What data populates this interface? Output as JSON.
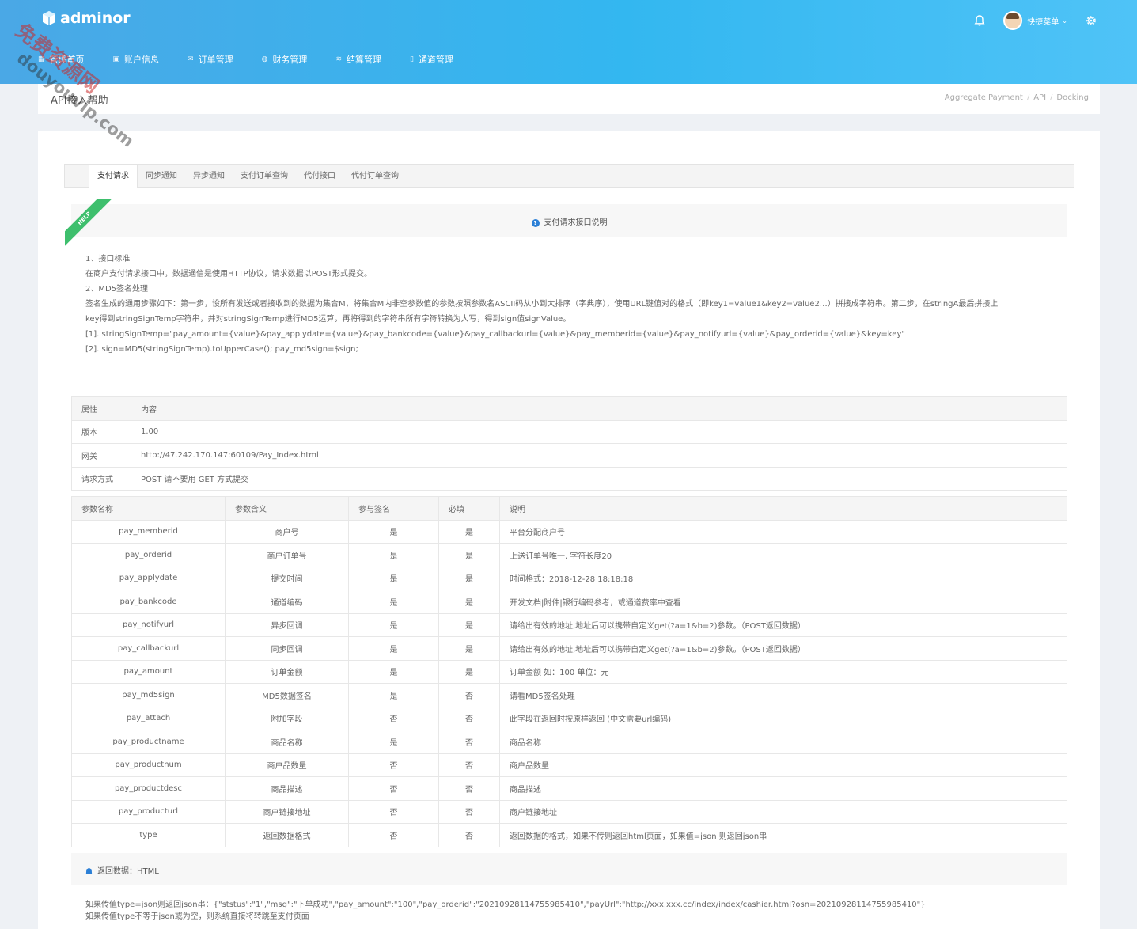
{
  "brand": {
    "name": "adminor"
  },
  "header": {
    "user_name": "快捷菜单",
    "caret": "⌄"
  },
  "nav": [
    {
      "label": "管理首页",
      "icon": "grid-icon"
    },
    {
      "label": "账户信息",
      "icon": "user-card-icon"
    },
    {
      "label": "订单管理",
      "icon": "mail-icon"
    },
    {
      "label": "财务管理",
      "icon": "globe-icon"
    },
    {
      "label": "结算管理",
      "icon": "layers-icon"
    },
    {
      "label": "通道管理",
      "icon": "file-icon"
    }
  ],
  "page": {
    "title": "API接入帮助",
    "breadcrumb": [
      "Aggregate Payment",
      "API",
      "Docking"
    ]
  },
  "tabs": [
    "支付请求",
    "同步通知",
    "异步通知",
    "支付订单查询",
    "代付接口",
    "代付订单查询"
  ],
  "help": {
    "ribbon": "HELP",
    "title": "支付请求接口说明"
  },
  "description": [
    "1、接口标准",
    "在商户支付请求接口中，数据通信是使用HTTP协议，请求数据以POST形式提交。",
    "2、MD5签名处理",
    "签名生成的通用步骤如下：第一步，设所有发送或者接收到的数据为集合M，将集合M内非空参数值的参数按照参数名ASCII码从小到大排序（字典序），使用URL键值对的格式（即key1=value1&key2=value2…）拼接成字符串。第二步，在stringA最后拼接上",
    "key得到stringSignTemp字符串，并对stringSignTemp进行MD5运算，再将得到的字符串所有字符转换为大写，得到sign值signValue。",
    "[1]. stringSignTemp=\"pay_amount={value}&pay_applydate={value}&pay_bankcode={value}&pay_callbackurl={value}&pay_memberid={value}&pay_notifyurl={value}&pay_orderid={value}&key=key\"",
    "[2]. sign=MD5(stringSignTemp).toUpperCase(); pay_md5sign=$sign;"
  ],
  "info_table": {
    "headers": [
      "属性",
      "内容"
    ],
    "rows": [
      [
        "版本",
        "1.00"
      ],
      [
        "网关",
        "http://47.242.170.147:60109/Pay_Index.html"
      ],
      [
        "请求方式",
        "POST 请不要用 GET 方式提交"
      ]
    ]
  },
  "param_table": {
    "headers": [
      "参数名称",
      "参数含义",
      "参与签名",
      "必填",
      "说明"
    ],
    "rows": [
      [
        "pay_memberid",
        "商户号",
        "是",
        "是",
        "平台分配商户号"
      ],
      [
        "pay_orderid",
        "商户订单号",
        "是",
        "是",
        "上送订单号唯一, 字符长度20"
      ],
      [
        "pay_applydate",
        "提交时间",
        "是",
        "是",
        "时间格式：2018-12-28 18:18:18"
      ],
      [
        "pay_bankcode",
        "通道编码",
        "是",
        "是",
        "开发文档|附件|银行编码参考，或通道费率中查看"
      ],
      [
        "pay_notifyurl",
        "异步回调",
        "是",
        "是",
        "请给出有效的地址,地址后可以携带自定义get(?a=1&b=2)参数。（POST返回数据）"
      ],
      [
        "pay_callbackurl",
        "同步回调",
        "是",
        "是",
        "请给出有效的地址,地址后可以携带自定义get(?a=1&b=2)参数。（POST返回数据）"
      ],
      [
        "pay_amount",
        "订单金额",
        "是",
        "是",
        "订单金额 如：100 单位：元"
      ],
      [
        "pay_md5sign",
        "MD5数据签名",
        "是",
        "否",
        "请看MD5签名处理"
      ],
      [
        "pay_attach",
        "附加字段",
        "否",
        "否",
        "此字段在返回时按原样返回 (中文需要url编码)"
      ],
      [
        "pay_productname",
        "商品名称",
        "是",
        "否",
        "商品名称"
      ],
      [
        "pay_productnum",
        "商户品数量",
        "否",
        "否",
        "商户品数量"
      ],
      [
        "pay_productdesc",
        "商品描述",
        "否",
        "否",
        "商品描述"
      ],
      [
        "pay_producturl",
        "商户链接地址",
        "否",
        "否",
        "商户链接地址"
      ],
      [
        "type",
        "返回数据格式",
        "否",
        "否",
        "返回数据的格式，如果不传则返回html页面，如果值=json 则返回json串"
      ]
    ]
  },
  "return_section": {
    "label": "返回数据：HTML"
  },
  "bottom_text": [
    "如果传值type=json则返回json串：{\"ststus\":\"1\",\"msg\":\"下单成功\",\"pay_amount\":\"100\",\"pay_orderid\":\"20210928114755985410\",\"payUrl\":\"http://xxx.xxx.cc/index/index/cashier.html?osn=20210928114755985410\"}",
    "如果传值type不等于json或为空，则系统直接将转跳至支付页面"
  ],
  "watermark": {
    "line1": "免费资源网",
    "line2": "douyouvip.com"
  },
  "colors": {
    "header_start": "#4aa8e6",
    "header_end": "#4fc3f7",
    "ribbon": "#3ebf6d",
    "accent": "#2b7fd6"
  }
}
